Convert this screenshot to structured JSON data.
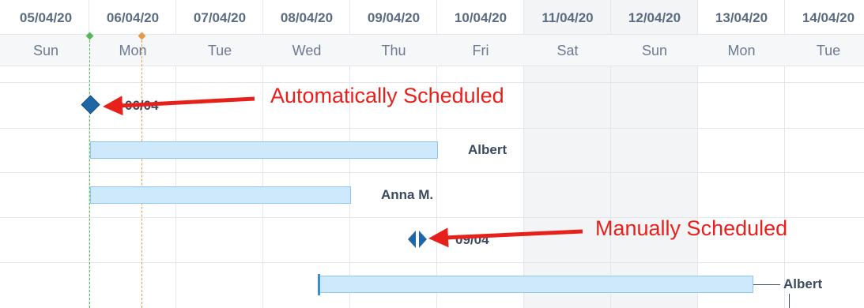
{
  "timeline": {
    "days": [
      {
        "date": "05/04/20",
        "dow": "Sun",
        "weekend": false
      },
      {
        "date": "06/04/20",
        "dow": "Mon",
        "weekend": false
      },
      {
        "date": "07/04/20",
        "dow": "Tue",
        "weekend": false
      },
      {
        "date": "08/04/20",
        "dow": "Wed",
        "weekend": false
      },
      {
        "date": "09/04/20",
        "dow": "Thu",
        "weekend": false
      },
      {
        "date": "10/04/20",
        "dow": "Fri",
        "weekend": false
      },
      {
        "date": "11/04/20",
        "dow": "Sat",
        "weekend": true
      },
      {
        "date": "12/04/20",
        "dow": "Sun",
        "weekend": true
      },
      {
        "date": "13/04/20",
        "dow": "Mon",
        "weekend": false
      },
      {
        "date": "14/04/20",
        "dow": "Tue",
        "weekend": false
      }
    ]
  },
  "tasks": {
    "milestone_auto": {
      "label": "06/04"
    },
    "bar1": {
      "resource": "Albert"
    },
    "bar2": {
      "resource": "Anna M."
    },
    "milestone_manual": {
      "label": "09/04"
    },
    "bar3": {
      "resource": "Albert"
    }
  },
  "annotations": {
    "auto": "Automatically Scheduled",
    "manual": "Manually Scheduled"
  },
  "colors": {
    "annotation": "#e8201b",
    "bar_fill": "#cde9fb",
    "milestone": "#1f67a4",
    "today_line": "#5bb55b",
    "project_start_line": "#e39a4a"
  }
}
